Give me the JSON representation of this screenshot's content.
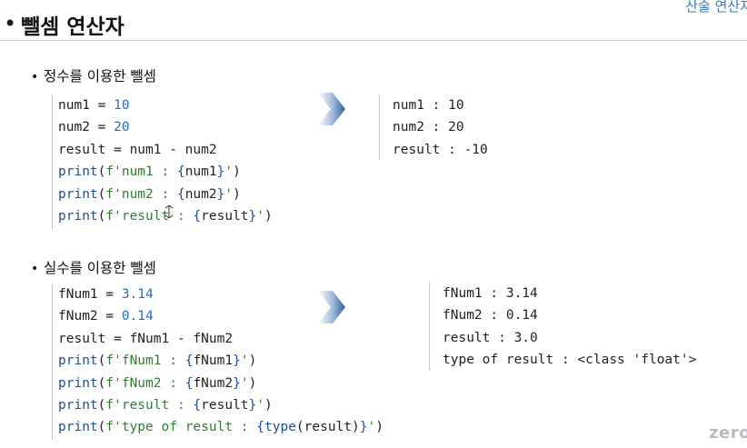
{
  "header": {
    "bullet": "•",
    "title": "뺄셈 연산자",
    "top_right_text": "산술 연산자"
  },
  "section1": {
    "bullet": "•",
    "title": "정수를 이용한 뺄셈",
    "code": {
      "l1_a": "num1 = ",
      "l1_num": "10",
      "l2_a": "num2 = ",
      "l2_num": "20",
      "l3": "result = num1 - num2",
      "l4_kw": "print",
      "l4_a": "(",
      "l4_s1": "f'num1 : ",
      "l4_b1": "{",
      "l4_v": "num1",
      "l4_b2": "}",
      "l4_s2": "'",
      "l4_e": ")",
      "l5_kw": "print",
      "l5_a": "(",
      "l5_s1": "f'num2 : ",
      "l5_b1": "{",
      "l5_v": "num2",
      "l5_b2": "}",
      "l5_s2": "'",
      "l5_e": ")",
      "l6_kw": "print",
      "l6_a": "(",
      "l6_s1": "f'result : ",
      "l6_b1": "{",
      "l6_v": "result",
      "l6_b2": "}",
      "l6_s2": "'",
      "l6_e": ")"
    },
    "output": [
      "num1 : 10",
      "num2 : 20",
      "result : -10"
    ]
  },
  "section2": {
    "bullet": "•",
    "title": "실수를 이용한 뺄셈",
    "code": {
      "l1_a": "fNum1 = ",
      "l1_num": "3.14",
      "l2_a": "fNum2 = ",
      "l2_num": "0.14",
      "l3": "result = fNum1 - fNum2",
      "l4_kw": "print",
      "l4_a": "(",
      "l4_s1": "f'fNum1 : ",
      "l4_b1": "{",
      "l4_v": "fNum1",
      "l4_b2": "}",
      "l4_s2": "'",
      "l4_e": ")",
      "l5_kw": "print",
      "l5_a": "(",
      "l5_s1": "f'fNum2 : ",
      "l5_b1": "{",
      "l5_v": "fNum2",
      "l5_b2": "}",
      "l5_s2": "'",
      "l5_e": ")",
      "l6_kw": "print",
      "l6_a": "(",
      "l6_s1": "f'result : ",
      "l6_b1": "{",
      "l6_v": "result",
      "l6_b2": "}",
      "l6_s2": "'",
      "l6_e": ")",
      "l7_kw": "print",
      "l7_a": "(",
      "l7_s1": "f'type of result : ",
      "l7_b1": "{",
      "l7_fn": "type",
      "l7_v": "(result)",
      "l7_b2": "}",
      "l7_s2": "'",
      "l7_e": ")"
    },
    "output": [
      "fNum1 : 3.14",
      "fNum2 : 0.14",
      "result : 3.0",
      "type of result : <class 'float'>"
    ]
  },
  "watermark": "zero",
  "colors": {
    "accent_blue": "#3b78c2",
    "number": "#1f6fc7",
    "keyword": "#1f4e96",
    "string": "#2e7d32",
    "arrow": "#2d5f9e"
  },
  "icons": [
    "arrow-right-icon",
    "cursor-icon"
  ]
}
